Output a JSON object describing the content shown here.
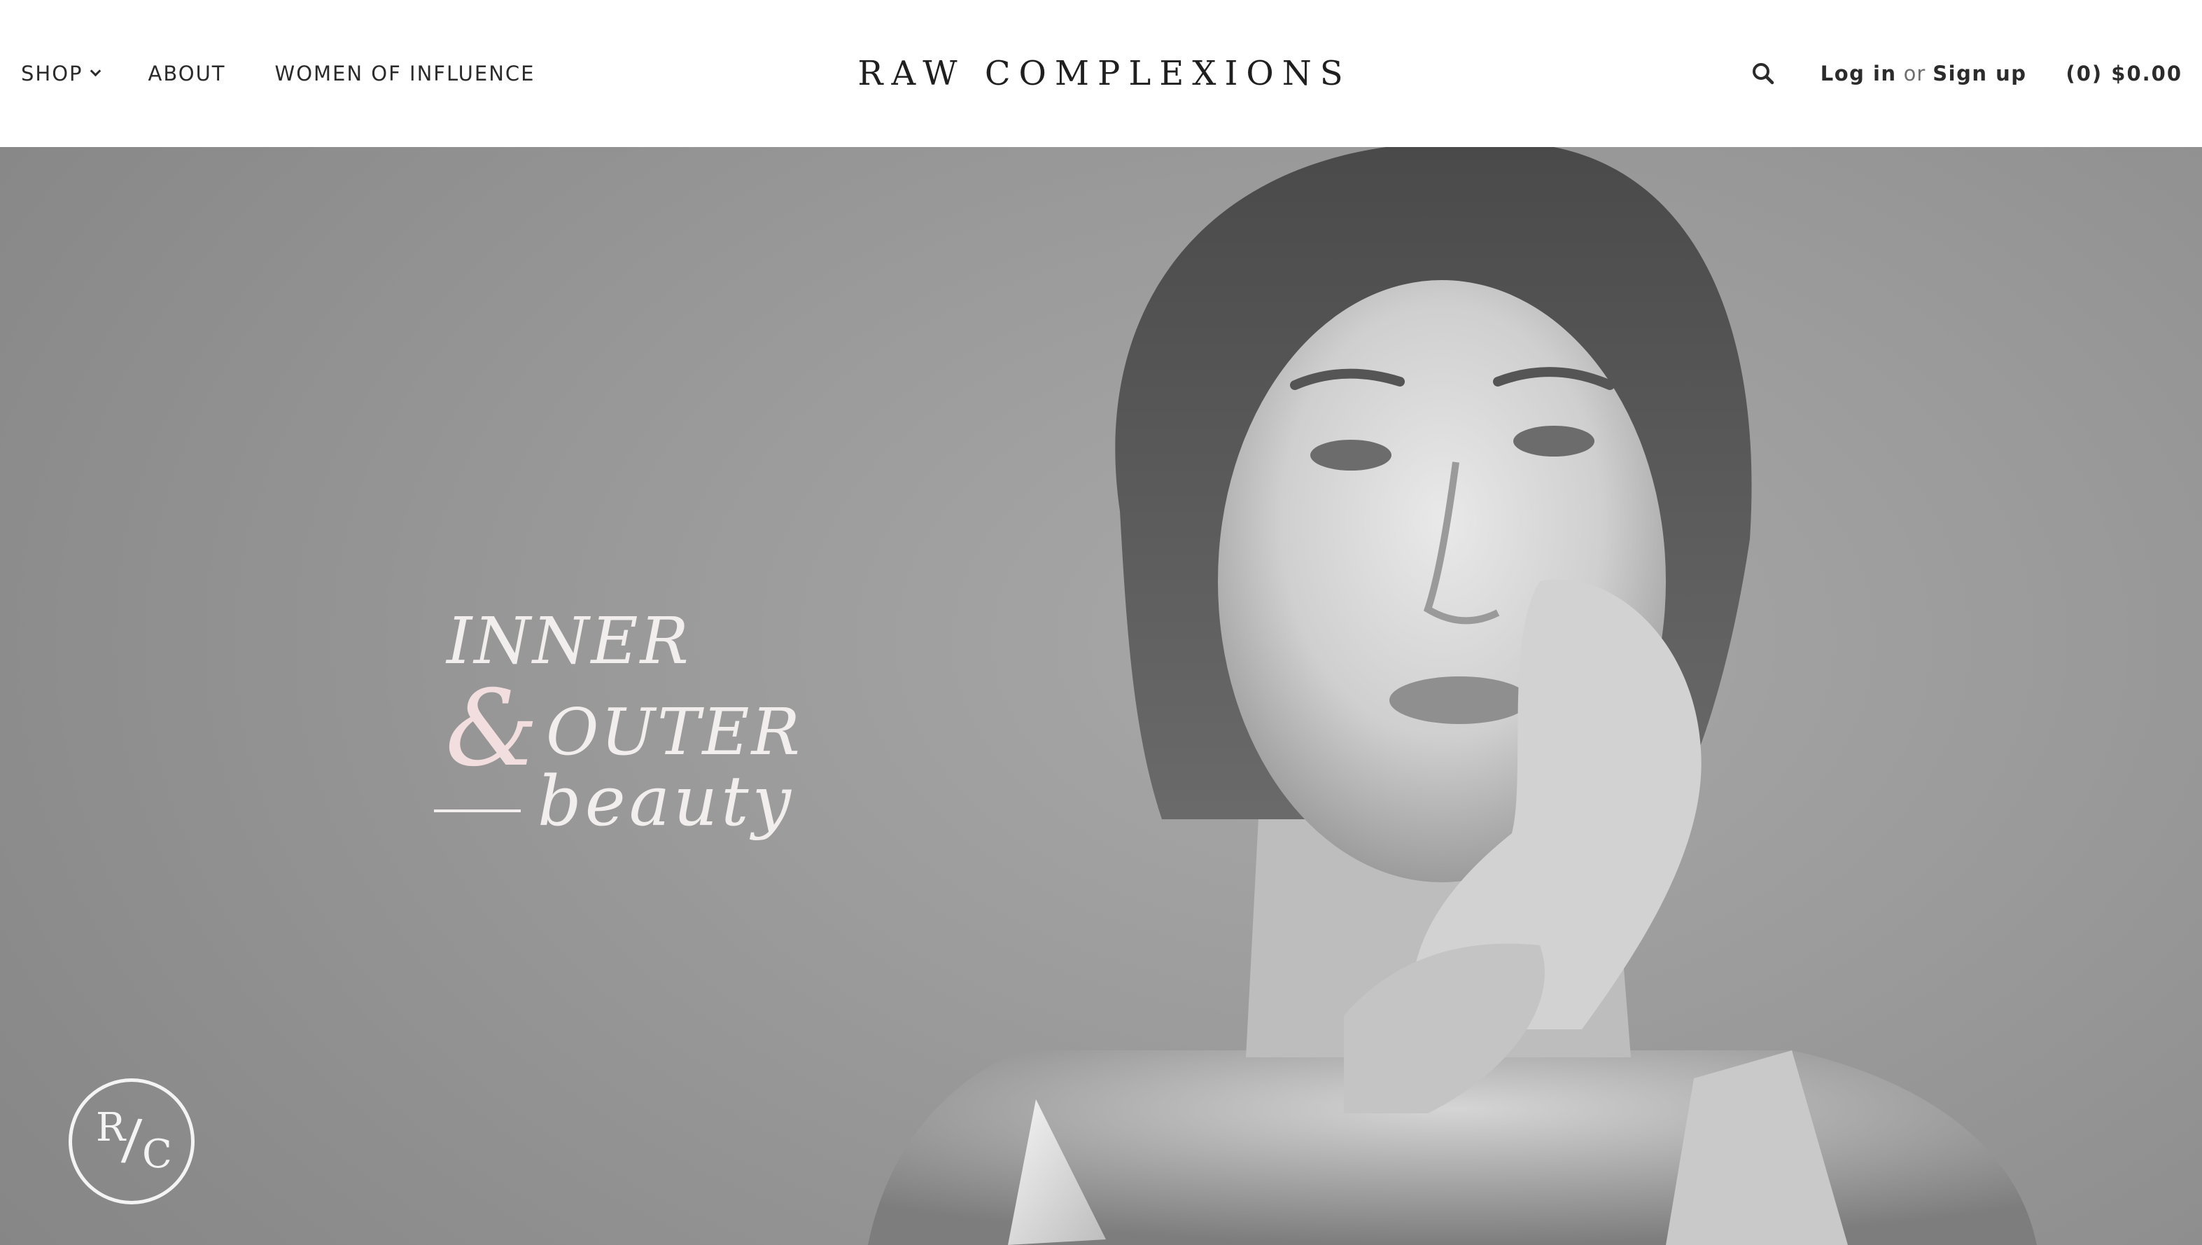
{
  "header": {
    "nav": [
      {
        "label": "SHOP",
        "has_dropdown": true
      },
      {
        "label": "ABOUT"
      },
      {
        "label": "WOMEN OF INFLUENCE"
      }
    ],
    "brand": "RAW COMPLEXIONS",
    "search_icon": "magnifying-glass",
    "login_label": "Log in",
    "or_label": "or",
    "signup_label": "Sign up",
    "cart_label": "(0) $0.00"
  },
  "hero": {
    "image": "black-and-white portrait of a woman with hands near her face",
    "tagline": {
      "line1": "INNER",
      "ampersand": "&",
      "line2": "OUTER",
      "line3": "beauty"
    },
    "badge": {
      "r": "R",
      "slash": "/",
      "c": "C"
    },
    "colors": {
      "tagline": "#f3eeee",
      "ampersand": "#f2dede",
      "background": "#9a9a9a"
    }
  }
}
